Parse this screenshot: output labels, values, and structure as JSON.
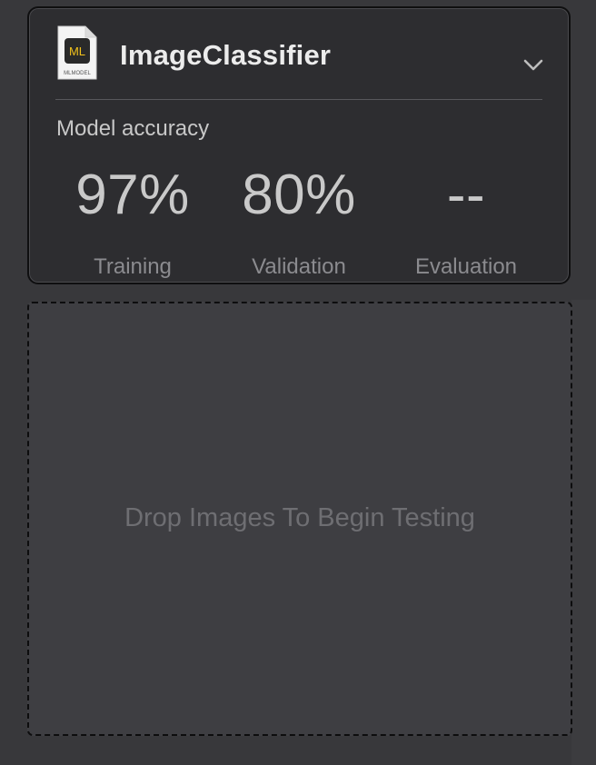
{
  "model": {
    "name": "ImageClassifier",
    "icon": "mlmodel-file-icon",
    "icon_badge": "ML",
    "icon_caption": "MLMODEL",
    "expand_icon": "chevron-down-icon"
  },
  "accuracy": {
    "label": "Model accuracy",
    "metrics": [
      {
        "name": "Training",
        "value": "97%"
      },
      {
        "name": "Validation",
        "value": "80%"
      },
      {
        "name": "Evaluation",
        "value": "--"
      }
    ]
  },
  "dropzone": {
    "label": "Drop Images To Begin Testing"
  },
  "colors": {
    "background": "#38383b",
    "card": "#2d2d30",
    "icon_badge_text": "#f2c21b"
  }
}
